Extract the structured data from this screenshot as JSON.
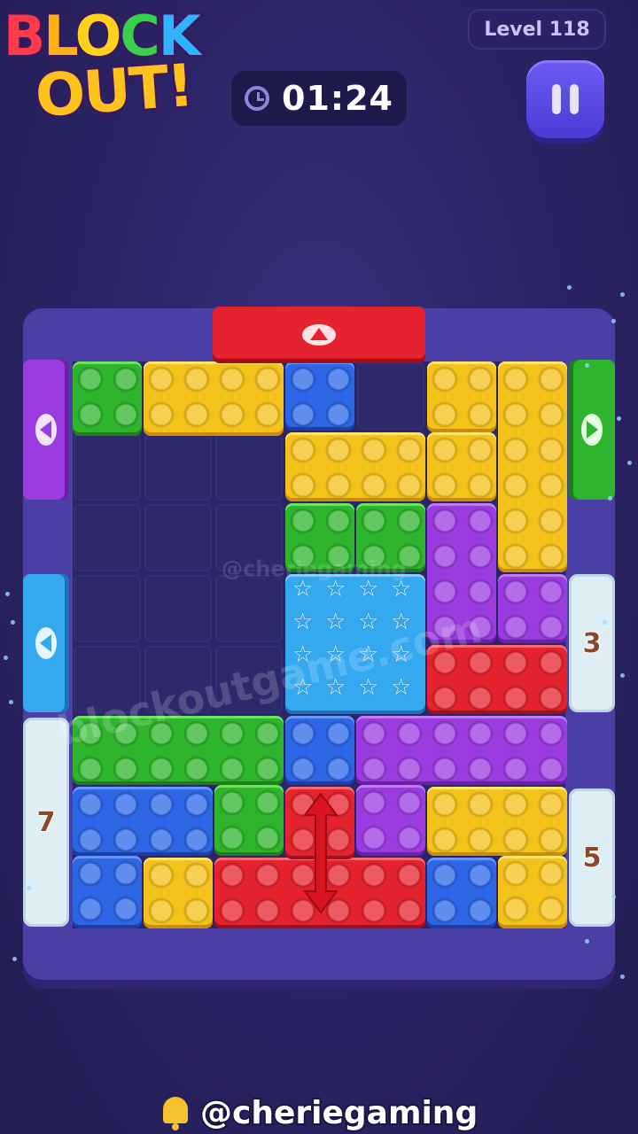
{
  "logo": {
    "line1": [
      "B",
      "L",
      "O",
      "C",
      "K"
    ],
    "line2": "OUT!"
  },
  "level": {
    "label": "Level 118"
  },
  "timer": {
    "value": "01:24",
    "icon": "clock-icon"
  },
  "pause": {
    "icon": "pause-icon"
  },
  "gates": {
    "left_top": {
      "color": "#9b3ce0",
      "direction": "left"
    },
    "left_mid": {
      "color": "#34a9ef",
      "direction": "left"
    },
    "left_frozen": {
      "count": "7"
    },
    "top": {
      "color": "#e5232f",
      "direction": "up"
    },
    "right_top": {
      "color": "#2fb52d",
      "direction": "right"
    },
    "right_frozen_a": {
      "count": "3"
    },
    "right_frozen_b": {
      "count": "5"
    }
  },
  "watermarks": {
    "site": "blockoutgame.com",
    "handle": "@cheriegaming"
  },
  "footer": {
    "handle": "@cheriegaming",
    "icon": "bell-icon"
  },
  "colors": {
    "yellow": "#f4c21b",
    "green": "#2fb52d",
    "blue": "#2d67e6",
    "purple": "#9b3ce0",
    "red": "#e5232f",
    "cyan": "#34a9ef"
  }
}
